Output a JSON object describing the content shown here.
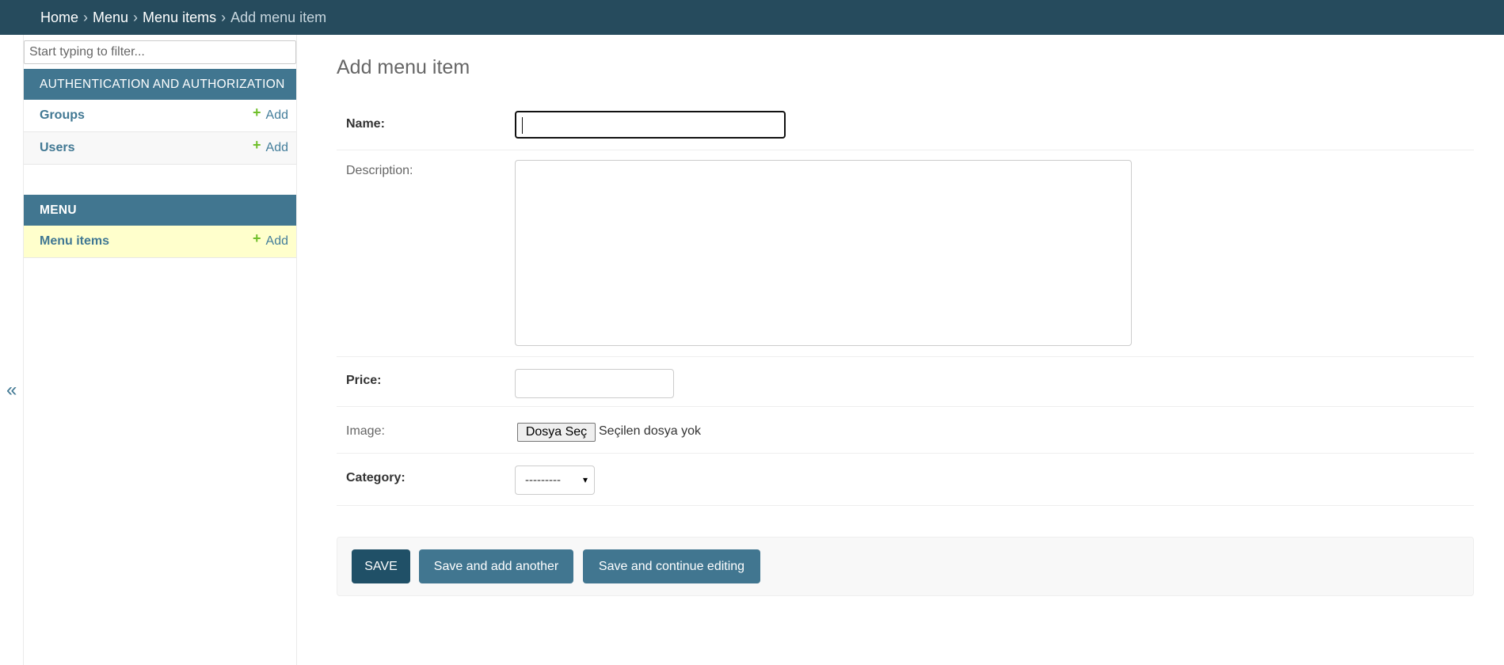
{
  "breadcrumbs": {
    "home": "Home",
    "menu": "Menu",
    "menu_items": "Menu items",
    "current": "Add menu item",
    "separator": "›"
  },
  "sidebar": {
    "toggle_icon": "«",
    "filter_placeholder": "Start typing to filter...",
    "modules": [
      {
        "caption": "AUTHENTICATION AND AUTHORIZATION",
        "items": [
          {
            "label": "Groups",
            "add_label": "Add"
          },
          {
            "label": "Users",
            "add_label": "Add"
          }
        ]
      },
      {
        "caption": "MENU",
        "items": [
          {
            "label": "Menu items",
            "add_label": "Add",
            "current": true
          }
        ]
      }
    ]
  },
  "page": {
    "title": "Add menu item"
  },
  "form": {
    "name_label": "Name:",
    "name_value": "",
    "description_label": "Description:",
    "description_value": "",
    "price_label": "Price:",
    "price_value": "",
    "image_label": "Image:",
    "file_button_label": "Dosya Seç",
    "file_status": "Seçilen dosya yok",
    "category_label": "Category:",
    "category_selected": "---------",
    "chevron_icon": "▾"
  },
  "submit": {
    "save": "SAVE",
    "save_add_another": "Save and add another",
    "save_continue": "Save and continue editing"
  },
  "colors": {
    "header_bg": "#264b5d",
    "module_caption_bg": "#417690",
    "current_row_bg": "#ffffcc",
    "add_plus": "#70bf2b",
    "save_button_bg": "#205067",
    "button_bg": "#417690"
  }
}
